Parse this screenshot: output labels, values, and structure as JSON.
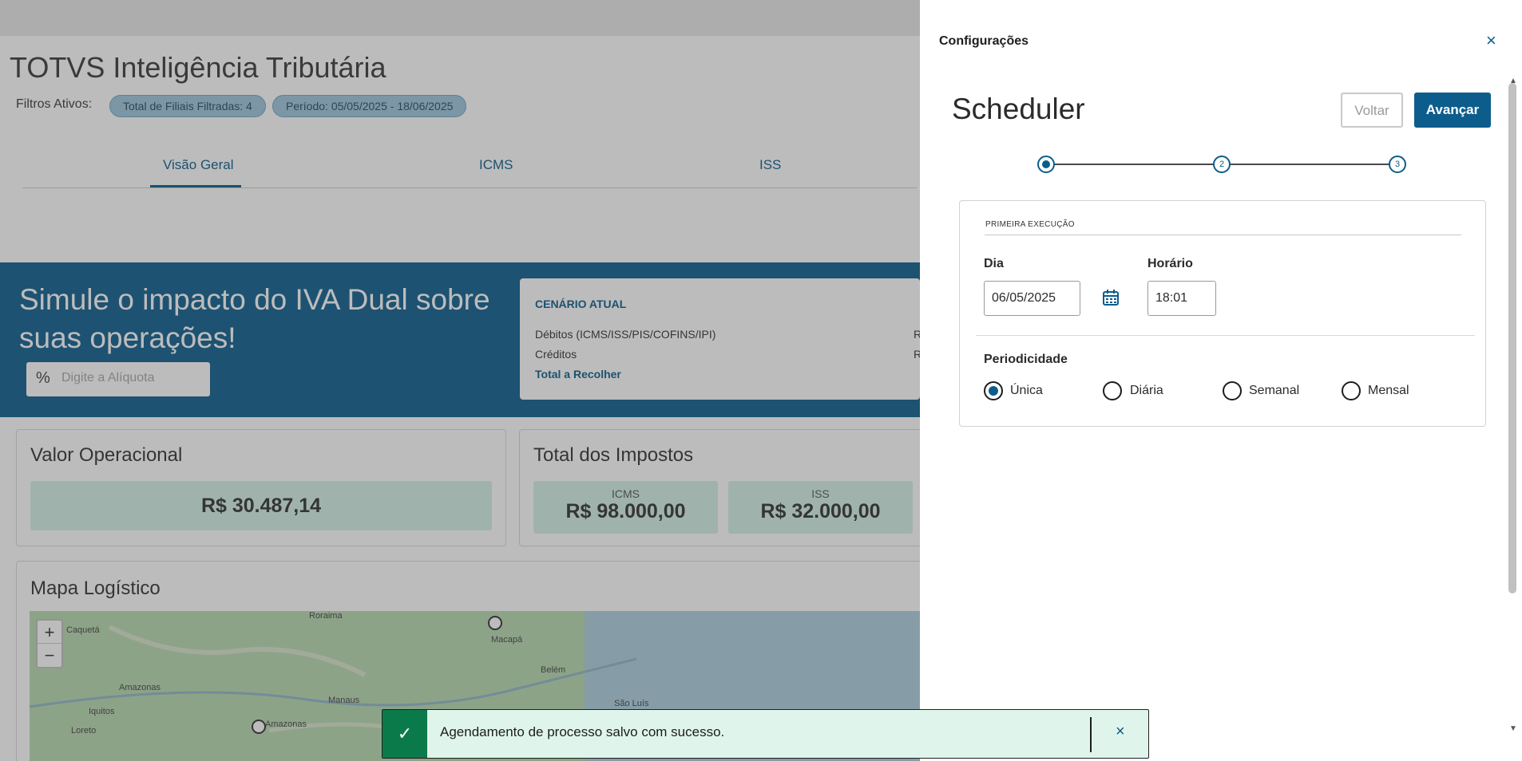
{
  "background": {
    "app_title": "TOTVS Inteligência Tributária",
    "filters_label": "Filtros Ativos:",
    "chips": [
      "Total de Filiais Filtradas: 4",
      "Período: 05/05/2025 - 18/06/2025"
    ],
    "tabs": [
      "Visão Geral",
      "ICMS",
      "ISS"
    ],
    "banner_title": "Simule o impacto do IVA Dual sobre suas operações!",
    "aliquota_placeholder": "Digite a Alíquota",
    "scenario": {
      "title": "CENÁRIO ATUAL",
      "debits": "Débitos (ICMS/ISS/PIS/COFINS/IPI)",
      "credits": "Créditos",
      "total": "Total a Recolher",
      "right_marks": [
        "R",
        "R"
      ]
    },
    "valor_operacional": {
      "title": "Valor Operacional",
      "value": "R$ 30.487,14"
    },
    "total_impostos": {
      "title": "Total dos Impostos",
      "items": [
        {
          "label": "ICMS",
          "value": "R$ 98.000,00"
        },
        {
          "label": "ISS",
          "value": "R$ 32.000,00"
        }
      ]
    },
    "map": {
      "title": "Mapa Logístico",
      "zoom_in": "+",
      "zoom_out": "−",
      "cities": [
        "Roraima",
        "Macapá",
        "Belém",
        "Manaus",
        "São Luís",
        "Amazonas",
        "Iquitos",
        "Loreto",
        "Caquetá",
        "Amazonas"
      ]
    }
  },
  "panel": {
    "title": "Configurações",
    "close_icon": "×",
    "heading": "Scheduler",
    "back_label": "Voltar",
    "next_label": "Avançar",
    "steps": [
      "1",
      "2",
      "3"
    ],
    "active_step": 1,
    "section_label": "PRIMEIRA EXECUÇÃO",
    "day_label": "Dia",
    "day_value": "06/05/2025",
    "time_label": "Horário",
    "time_value": "18:01",
    "periodicity_label": "Periodicidade",
    "options": [
      "Única",
      "Diária",
      "Semanal",
      "Mensal"
    ],
    "selected_option": "Única"
  },
  "toast": {
    "message": "Agendamento de processo salvo com sucesso.",
    "icon": "✓",
    "close_icon": "×"
  },
  "colors": {
    "primary": "#0c5d8c",
    "success": "#0b7a4b",
    "toast_bg": "#dff5ec",
    "value_bg": "#d4f1e7"
  }
}
